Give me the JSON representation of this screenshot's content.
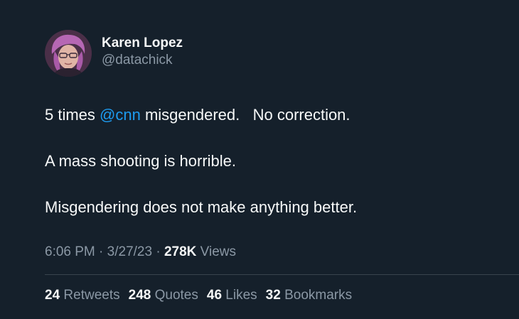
{
  "user": {
    "display_name": "Karen Lopez",
    "handle": "@datachick"
  },
  "tweet": {
    "line1_prefix": "5 times ",
    "line1_mention": "@cnn",
    "line1_suffix": " misgendered.   No correction.",
    "line2": "A mass shooting is horrible.",
    "line3": "Misgendering does not make anything better."
  },
  "meta": {
    "time": "6:06 PM",
    "sep1": " · ",
    "date": "3/27/23",
    "sep2": " · ",
    "views_count": "278K",
    "views_label": " Views"
  },
  "stats": [
    {
      "count": "24",
      "label": " Retweets"
    },
    {
      "count": "248",
      "label": " Quotes"
    },
    {
      "count": "46",
      "label": " Likes"
    },
    {
      "count": "32",
      "label": " Bookmarks"
    }
  ],
  "colors": {
    "background": "#15202b",
    "text": "#f7f9f9",
    "secondary": "#8b98a5",
    "link": "#1d9bf0",
    "divider": "#38444d"
  }
}
